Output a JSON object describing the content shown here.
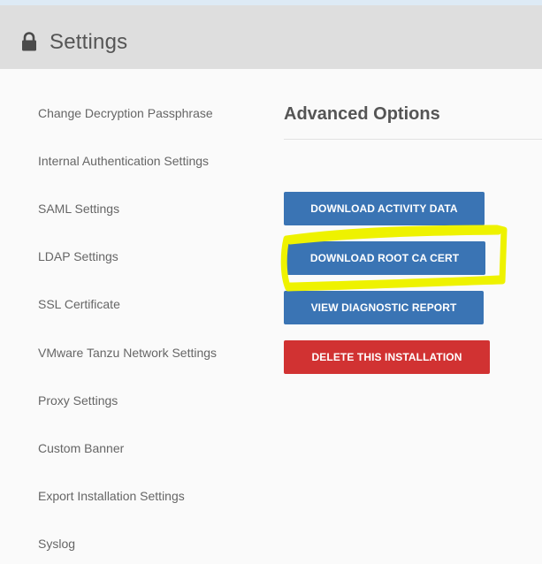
{
  "header": {
    "title": "Settings",
    "icon": "lock-icon"
  },
  "sidebar": {
    "items": [
      {
        "label": "Change Decryption Passphrase"
      },
      {
        "label": "Internal Authentication Settings"
      },
      {
        "label": "SAML Settings"
      },
      {
        "label": "LDAP Settings"
      },
      {
        "label": "SSL Certificate"
      },
      {
        "label": "VMware Tanzu Network Settings"
      },
      {
        "label": "Proxy Settings"
      },
      {
        "label": "Custom Banner"
      },
      {
        "label": "Export Installation Settings"
      },
      {
        "label": "Syslog"
      }
    ]
  },
  "main": {
    "section_title": "Advanced Options",
    "buttons": {
      "download_activity": "DOWNLOAD ACTIVITY DATA",
      "download_root_ca": "DOWNLOAD ROOT CA CERT",
      "view_diagnostic": "VIEW DIAGNOSTIC REPORT",
      "delete_installation": "DELETE THIS INSTALLATION"
    }
  },
  "colors": {
    "primary_button": "#3a74b4",
    "danger_button": "#d13232",
    "highlight_annotation": "#eef200"
  }
}
